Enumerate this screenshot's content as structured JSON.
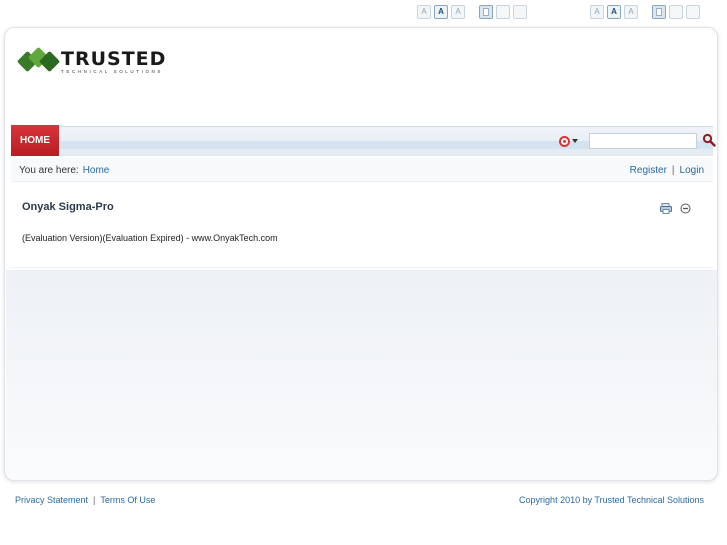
{
  "top_controls": {
    "set1": {
      "font_sizes": [
        "A",
        "A",
        "A"
      ],
      "active_font_index": 1
    },
    "set2": {
      "font_sizes": [
        "A",
        "A",
        "A"
      ],
      "active_font_index": 1
    }
  },
  "logo": {
    "title": "TRUSTED",
    "subtitle": "TECHNICAL SOLUTIONS"
  },
  "nav": {
    "home_label": "HOME",
    "search_value": ""
  },
  "breadcrumb": {
    "prefix": "You are here:",
    "home_link": "Home",
    "register": "Register",
    "separator": "|",
    "login": "Login"
  },
  "module": {
    "title": "Onyak Sigma-Pro",
    "body": "(Evaluation Version)(Evaluation Expired) - www.OnyakTech.com"
  },
  "footer": {
    "privacy": "Privacy Statement",
    "separator": "|",
    "terms": "Terms Of Use",
    "copyright": "Copyright 2010 by Trusted Technical Solutions"
  },
  "colors": {
    "accent_red": "#c8252c",
    "link_blue": "#2a6aa0",
    "logo_green": "#3b7a2a"
  },
  "icons": [
    "search-type-icon",
    "search-icon",
    "print-icon",
    "minimize-icon",
    "logo-icon"
  ]
}
